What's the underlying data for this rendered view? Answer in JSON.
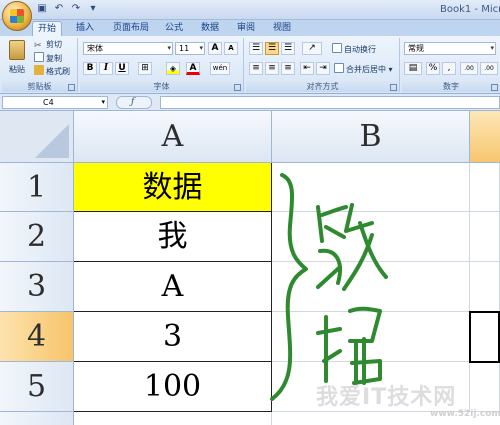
{
  "window": {
    "title": "Book1 - Micro",
    "qat_icons": [
      "save-icon",
      "undo-icon",
      "redo-icon",
      "customize-icon"
    ]
  },
  "tabs": [
    {
      "label": "开始",
      "active": true
    },
    {
      "label": "插入",
      "active": false
    },
    {
      "label": "页面布局",
      "active": false
    },
    {
      "label": "公式",
      "active": false
    },
    {
      "label": "数据",
      "active": false
    },
    {
      "label": "审阅",
      "active": false
    },
    {
      "label": "视图",
      "active": false
    }
  ],
  "ribbon": {
    "clipboard": {
      "label": "剪贴板",
      "paste": "粘贴",
      "cut": "剪切",
      "copy": "复制",
      "format_painter": "格式刷"
    },
    "font": {
      "label": "字体",
      "font_name": "宋体",
      "font_size": "11",
      "grow": "A",
      "shrink": "A",
      "bold": "B",
      "italic": "I",
      "underline": "U",
      "font_color_letter": "A",
      "pinyin_glyph": "wén"
    },
    "alignment": {
      "label": "对齐方式",
      "wrap_text": "自动换行",
      "merge_center": "合并后居中"
    },
    "number": {
      "label": "数字",
      "format": "常规",
      "percent": "%",
      "comma": ",",
      "inc_decimal": ".00",
      "dec_decimal": ".00"
    }
  },
  "formula_bar": {
    "name_box": "C4",
    "formula": ""
  },
  "sheet": {
    "columns": [
      {
        "label": "A",
        "selected": false
      },
      {
        "label": "B",
        "selected": false
      },
      {
        "label": "",
        "selected": true
      }
    ],
    "rows": [
      {
        "label": "1",
        "selected": false,
        "value": "数据",
        "highlight": "#ffff00"
      },
      {
        "label": "2",
        "selected": false,
        "value": "我",
        "highlight": ""
      },
      {
        "label": "3",
        "selected": false,
        "value": "A",
        "highlight": ""
      },
      {
        "label": "4",
        "selected": true,
        "value": "3",
        "highlight": ""
      },
      {
        "label": "5",
        "selected": false,
        "value": "100",
        "highlight": ""
      }
    ],
    "active_cell": "C4",
    "handwriting_color": "#2f8a2f"
  },
  "watermark": {
    "text": "我爱IT技术网",
    "url": "www.52ij.com"
  }
}
